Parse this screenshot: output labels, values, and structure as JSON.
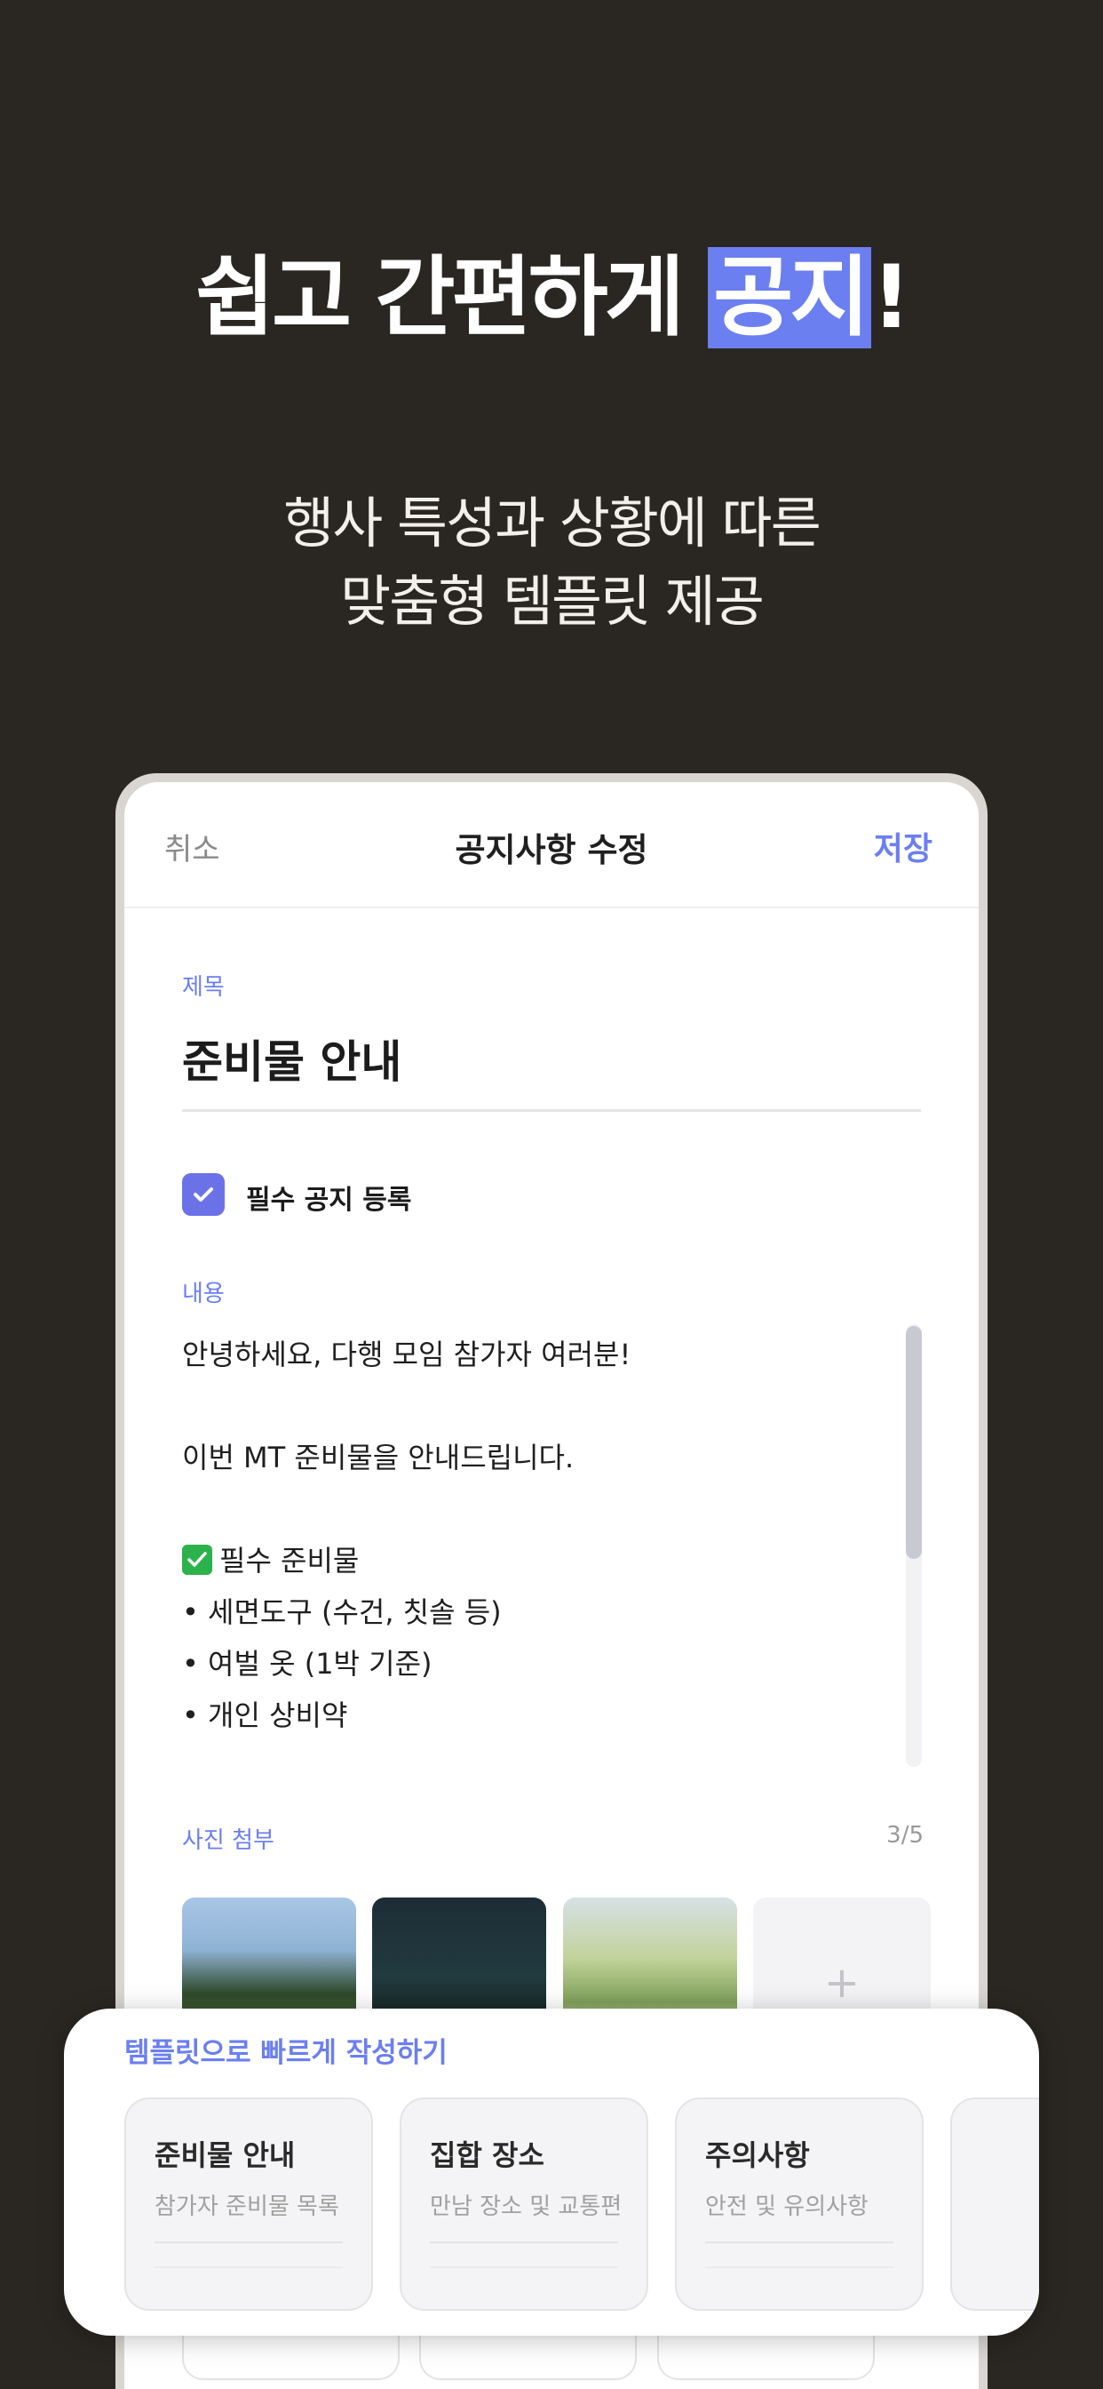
{
  "hero": {
    "headline_prefix": "쉽고 간편하게 ",
    "headline_highlight": "공지",
    "headline_suffix": "!",
    "subtitle_line1": "행사 특성과 상황에 따른",
    "subtitle_line2": "맞춤형 템플릿 제공"
  },
  "nav": {
    "cancel": "취소",
    "title": "공지사항 수정",
    "save": "저장"
  },
  "form": {
    "title_label": "제목",
    "title_value": "준비물 안내",
    "required_checked": true,
    "required_label": "필수 공지 등록",
    "content_label": "내용",
    "content_lines": [
      "안녕하세요, 다행 모임 참가자 여러분!",
      "",
      "이번 MT 준비물을 안내드립니다.",
      "",
      "필수 준비물",
      "• 세면도구 (수건, 칫솔 등)",
      "• 여벌 옷 (1박 기준)",
      "• 개인 상비약"
    ],
    "photo_label": "사진 첨부",
    "photo_count": "3/5",
    "add_photo": "+"
  },
  "templates": {
    "title": "템플릿으로 빠르게 작성하기",
    "items": [
      {
        "title": "준비물 안내",
        "desc": "참가자 준비물 목록"
      },
      {
        "title": "집합 장소",
        "desc": "만남 장소 및 교통편"
      },
      {
        "title": "주의사항",
        "desc": "안전 및 유의사항"
      }
    ]
  },
  "colors": {
    "accent": "#6b7ff0",
    "background": "#2a2621",
    "checkbox": "#6b72e8",
    "check_emoji": "#2bb24c"
  }
}
